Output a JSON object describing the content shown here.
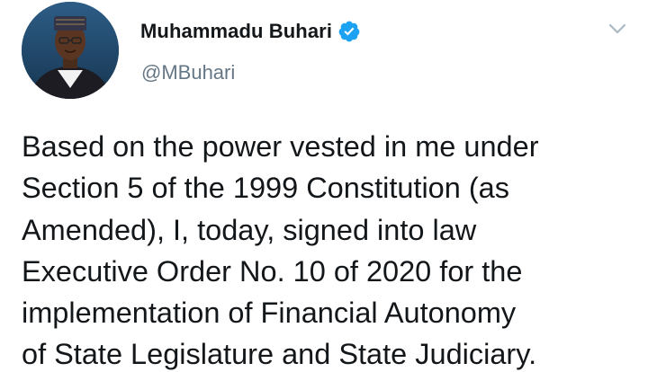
{
  "author": {
    "display_name": "Muhammadu Buhari",
    "handle": "@MBuhari",
    "verified": true,
    "avatar_icon": "profile-photo"
  },
  "tweet": {
    "lines": [
      "Based on the power vested in me under",
      "Section 5 of the 1999 Constitution (as",
      "Amended), I, today, signed into law",
      "Executive Order No. 10 of 2020 for the",
      "implementation of Financial Autonomy",
      "of State Legislature and State Judiciary."
    ]
  },
  "icons": {
    "verified": "verified-badge-icon",
    "menu": "chevron-down-icon"
  },
  "colors": {
    "verified_blue": "#1da1f2",
    "handle_gray": "#657786",
    "text": "#14171a",
    "caret_gray": "#aab8c2"
  }
}
